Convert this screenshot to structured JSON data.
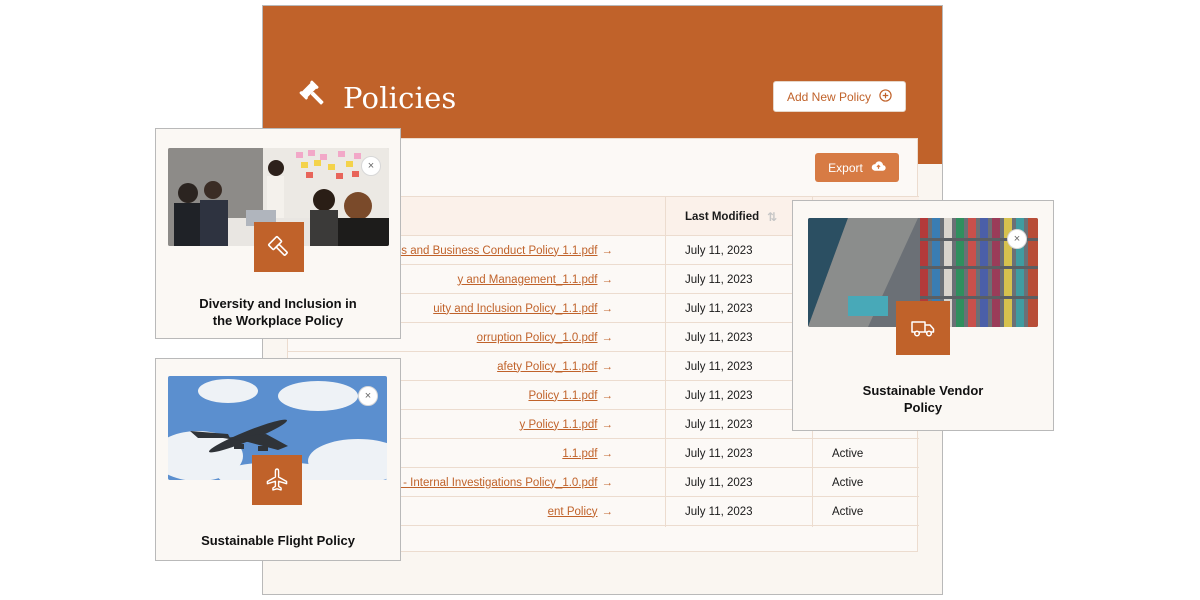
{
  "header": {
    "title": "Policies",
    "add_button": "Add New Policy"
  },
  "toolbar": {
    "export_label": "Export"
  },
  "table": {
    "headers": {
      "modified": "Last Modified"
    },
    "rows": [
      {
        "name": "ics and Business Conduct Policy 1.1.pdf",
        "date": "July 11, 2023",
        "status": ""
      },
      {
        "name": "y and Management_1.1.pdf",
        "date": "July 11, 2023",
        "status": ""
      },
      {
        "name": "uity and Inclusion Policy_1.1.pdf",
        "date": "July 11, 2023",
        "status": ""
      },
      {
        "name": "orruption Policy_1.0.pdf",
        "date": "July 11, 2023",
        "status": ""
      },
      {
        "name": "afety Policy_1.1.pdf",
        "date": "July 11, 2023",
        "status": ""
      },
      {
        "name": "Policy 1.1.pdf",
        "date": "July 11, 2023",
        "status": ""
      },
      {
        "name": "y Policy 1.1.pdf",
        "date": "July 11, 2023",
        "status": ""
      },
      {
        "name": "1.1.pdf",
        "date": "July 11, 2023",
        "status": "Active"
      },
      {
        "name": "er - Internal Investigations Policy_1.0.pdf",
        "date": "July 11, 2023",
        "status": "Active"
      },
      {
        "name": "ent Policy",
        "date": "July 11, 2023",
        "status": "Active"
      }
    ]
  },
  "cards": {
    "diversity": {
      "title_line1": "Diversity and Inclusion in",
      "title_line2": "the Workplace Policy",
      "icon": "gavel-icon"
    },
    "flight": {
      "title": "Sustainable Flight Policy",
      "icon": "airplane-icon"
    },
    "vendor": {
      "title_line1": "Sustainable Vendor",
      "title_line2": "Policy",
      "icon": "truck-icon"
    }
  },
  "icons": {
    "close": "×",
    "arrow": "→"
  },
  "colors": {
    "brand": "#c0622a",
    "export": "#d77b44",
    "panel_bg": "#faf6f1"
  }
}
